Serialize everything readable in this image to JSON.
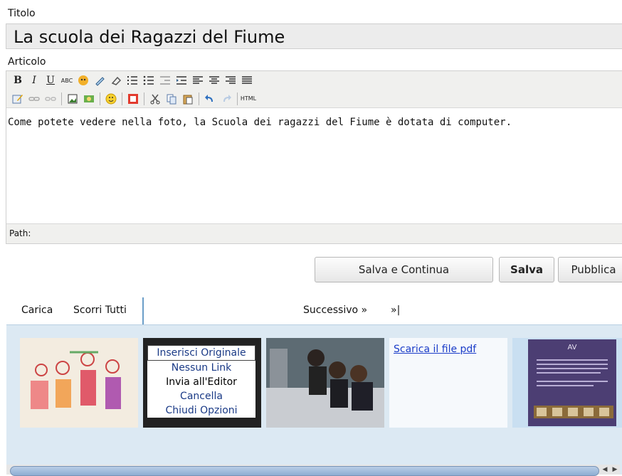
{
  "form": {
    "title_label": "Titolo",
    "title_value": "La scuola dei Ragazzi del Fiume",
    "article_label": "Articolo"
  },
  "editor": {
    "content": "Come potete vedere nella foto, la Scuola dei ragazzi del Fiume è dotata di computer.",
    "path_label": "Path:",
    "toolbar_row1": [
      "bold-icon",
      "italic-icon",
      "underline-icon",
      "strikethrough-icon",
      "spellcheck-icon",
      "highlight-icon",
      "eraser-icon",
      "ordered-list-icon",
      "unordered-list-icon",
      "outdent-icon",
      "indent-icon",
      "align-left-icon",
      "align-center-icon",
      "align-right-icon",
      "align-justify-icon"
    ],
    "toolbar_row2": [
      "edit-icon",
      "link-icon",
      "unlink-icon",
      "image-icon",
      "media-icon",
      "smiley-icon",
      "stop-icon",
      "cut-icon",
      "copy-icon",
      "paste-icon",
      "undo-icon",
      "redo-icon",
      "html-icon"
    ],
    "html_label": "HTML"
  },
  "actions": {
    "save_continue": "Salva e Continua",
    "save": "Salva",
    "publish": "Pubblica"
  },
  "gallery": {
    "tabs": [
      "Carica",
      "Scorri Tutti"
    ],
    "next": "Successivo »",
    "last": "»|",
    "menu": [
      "Inserisci Originale",
      "Nessun Link",
      "Invia all'Editor",
      "Cancella",
      "Chiudi Opzioni"
    ],
    "pdf_link": "Scarica il file pdf",
    "thumb_caption_5": "AV"
  },
  "colors": {
    "tab_border": "#6b9ec8",
    "gallery_bg": "#dce9f3",
    "link": "#1a3cc8"
  }
}
